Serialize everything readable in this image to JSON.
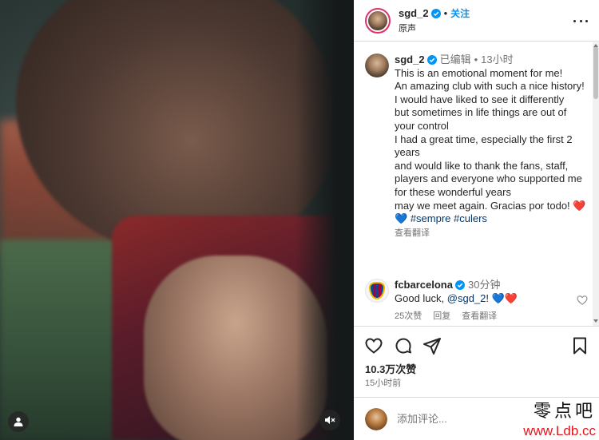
{
  "post": {
    "username": "sgd_2",
    "follow_label": "关注",
    "audio_label": "原声"
  },
  "caption": {
    "username": "sgd_2",
    "edited_label": "已编辑",
    "time": "13小时",
    "text": "This is an emotional moment for me!\nAn amazing club with such a nice history! I would have liked to see it differently\nbut sometimes in life things are out of your control\nI had a great time, especially the first 2 years\nand would like to thank the fans, staff, players and everyone who supported me for these wonderful years\nmay we meet again. Gracias por todo!",
    "emoji": "❤️💙",
    "hashtags": "#sempre #culers",
    "translate_label": "查看翻译"
  },
  "comment": {
    "username": "fcbarcelona",
    "time": "30分钟",
    "text": "Good luck, ",
    "mention": "@sgd_2",
    "after_mention": "! 💙❤️",
    "likes": "25次赞",
    "reply_label": "回复",
    "translate_label": "查看翻译"
  },
  "actions": {
    "likes_count": "10.3万次赞",
    "time_ago": "15小时前"
  },
  "comment_input": {
    "placeholder": "添加评论..."
  },
  "watermark": {
    "top": "零点吧",
    "bottom": "www.Ldb.cc"
  },
  "icons": {
    "user_tag": "user-tag-icon",
    "mute": "speaker-muted-icon",
    "like": "heart-icon",
    "comment": "comment-icon",
    "share": "share-icon",
    "save": "bookmark-icon",
    "more": "more-icon"
  },
  "colors": {
    "verified": "#0095f6",
    "follow": "#0095f6",
    "hashtag": "#00376b",
    "secondary_text": "#737373"
  }
}
